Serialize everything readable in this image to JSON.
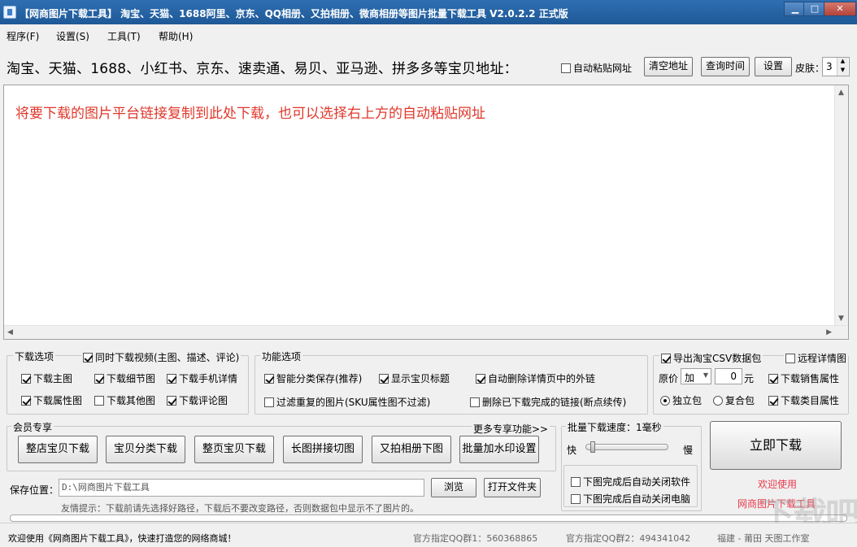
{
  "window": {
    "title": "【网商图片下载工具】 淘宝、天猫、1688阿里、京东、QQ相册、又拍相册、微商相册等图片批量下载工具 V2.0.2.2 正式版",
    "minimize_icon": "minimize-icon",
    "maximize_icon": "maximize-icon",
    "close_icon": "close-icon"
  },
  "menu": {
    "items": [
      "程序(F)",
      "设置(S)",
      "工具(T)",
      "帮助(H)"
    ]
  },
  "header": {
    "platforms_label": "淘宝、天猫、1688、小红书、京东、速卖通、易贝、亚马逊、拼多多等宝贝地址：",
    "auto_paste_label": "自动粘贴网址",
    "auto_paste_checked": false,
    "clear_button": "清空地址",
    "query_time_button": "查询时间",
    "settings_button": "设置",
    "skin_label": "皮肤：",
    "skin_value": "3"
  },
  "url_area": {
    "placeholder": "将要下载的图片平台链接复制到此处下载，也可以选择右上方的自动粘贴网址"
  },
  "download_options": {
    "group_title": "下载选项",
    "video": {
      "label": "同时下载视频(主图、描述、评论)",
      "checked": true
    },
    "items": [
      {
        "label": "下载主图",
        "checked": true
      },
      {
        "label": "下载细节图",
        "checked": true
      },
      {
        "label": "下载手机详情",
        "checked": true
      },
      {
        "label": "下载属性图",
        "checked": true
      },
      {
        "label": "下载其他图",
        "checked": false
      },
      {
        "label": "下载评论图",
        "checked": true
      }
    ]
  },
  "function_options": {
    "group_title": "功能选项",
    "items": [
      {
        "label": "智能分类保存(推荐)",
        "checked": true
      },
      {
        "label": "显示宝贝标题",
        "checked": true
      },
      {
        "label": "自动删除详情页中的外链",
        "checked": true
      },
      {
        "label": "过滤重复的图片(SKU属性图不过滤)",
        "checked": false
      },
      {
        "label": "删除已下载完成的链接(断点续传)",
        "checked": false
      }
    ]
  },
  "csv_options": {
    "export_csv": {
      "label": "导出淘宝CSV数据包",
      "checked": true
    },
    "remote_detail": {
      "label": "远程详情图",
      "checked": false
    },
    "price_label": "原价",
    "price_op": "加",
    "price_value": "0",
    "price_unit": "元",
    "sales_attr": {
      "label": "下载销售属性",
      "checked": true
    },
    "single_pack": {
      "label": "独立包",
      "checked": true
    },
    "combined_pack": {
      "label": "复合包",
      "checked": false
    },
    "category_attr": {
      "label": "下载类目属性",
      "checked": true
    }
  },
  "member": {
    "group_title": "会员专享",
    "more_link": "更多专享功能>>",
    "buttons": [
      "整店宝贝下载",
      "宝贝分类下载",
      "整页宝贝下载",
      "长图拼接切图",
      "又拍相册下图",
      "批量加水印设置"
    ]
  },
  "speed": {
    "group_title": "批量下载速度：1毫秒",
    "fast_label": "快",
    "slow_label": "慢",
    "slider_level": 0.05,
    "close_app": {
      "label": "下图完成后自动关闭软件",
      "checked": false
    },
    "shutdown": {
      "label": "下图完成后自动关闭电脑",
      "checked": false
    }
  },
  "download_now": {
    "button": "立即下载",
    "welcome": "欢迎使用",
    "app_name": "网商图片下载工具"
  },
  "save": {
    "label": "保存位置：",
    "path": "D:\\网商图片下载工具",
    "browse_button": "浏览",
    "open_folder_button": "打开文件夹",
    "tip": "友情提示：下载前请先选择好路径，下载后不要改变路径，否则数据包中显示不了图片的。"
  },
  "status": {
    "welcome": "欢迎使用《网商图片下载工具》，快速打造您的网络商城！",
    "qq1": "官方指定QQ群1：560368865",
    "qq2": "官方指定QQ群2：494341042",
    "author": "福建 - 莆田  天图工作室"
  },
  "colors": {
    "titlebar": "#1e5897",
    "hint_red": "#e0382b",
    "welcome_red": "#e8394b"
  },
  "watermark_text": "下载吧"
}
